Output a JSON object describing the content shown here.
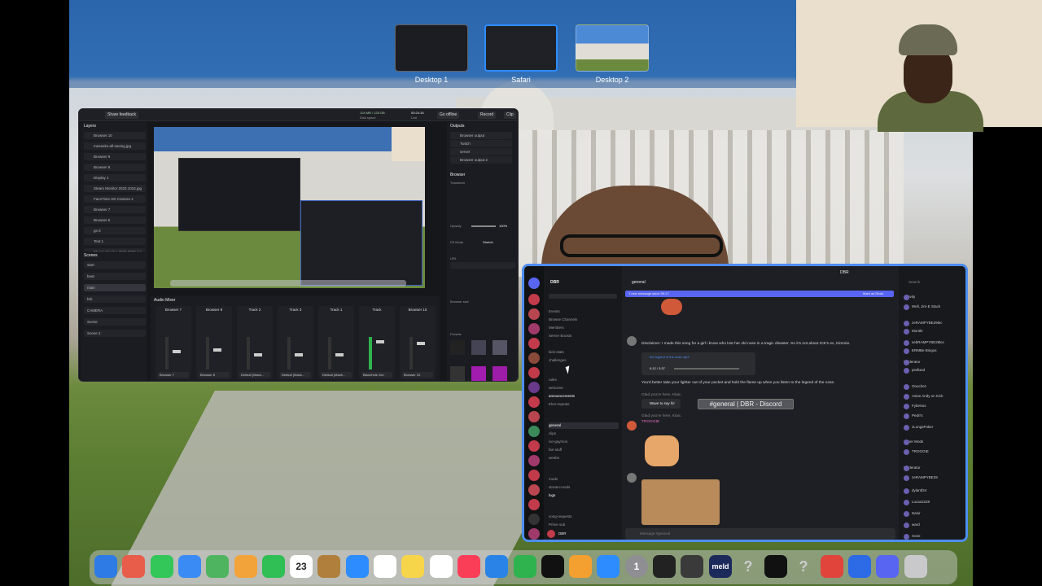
{
  "mission_control": {
    "spaces": [
      {
        "label": "Desktop 1",
        "selected": false
      },
      {
        "label": "Safari",
        "selected": true
      },
      {
        "label": "Desktop 2",
        "selected": false
      }
    ]
  },
  "obs": {
    "share_button": "Share feedback",
    "status_line1": "104 MB / 128 GB",
    "status_line2": "Disk space",
    "live_time": "00:24:16",
    "live_label": "Live",
    "go_offline": "Go offline",
    "record": "Record",
    "clip": "Clip",
    "sources_title": "Layers",
    "sources": [
      "Browser 10",
      "meseeks-all-seeing.jpg",
      "Browser 9",
      "Browser 8",
      "Display 1",
      "Steam Monitor 2023.1024.jpg",
      "FaceTime HD Camera 1",
      "Browser 7",
      "Browser 6",
      "gs-2",
      "Text 1",
      "Steam Monitor 2023.0720.jpg"
    ],
    "scenes_title": "Scenes",
    "scenes": [
      "start",
      "beat",
      "main",
      "brb",
      "CAMERA",
      "Scene",
      "Scene 2"
    ],
    "outputs_title": "Outputs",
    "outputs": [
      "Browser output",
      "Twitch",
      "server",
      "Browser output 2"
    ],
    "props_title": "Browser",
    "props_labels": [
      "Transform",
      "Opacity",
      "Fill Mode",
      "URL",
      "Browser size",
      "Presets"
    ],
    "opacity_value": "100%",
    "fill_mode": "Stretch",
    "mixer_title": "Audio Mixer",
    "channels": [
      {
        "name": "Browser 7",
        "select": "Browser 7"
      },
      {
        "name": "Browser 8",
        "select": "Browser 8"
      },
      {
        "name": "Track 2",
        "select": "Default (Macb..."
      },
      {
        "name": "Track 3",
        "select": "Default (Macb..."
      },
      {
        "name": "Track 1",
        "select": "Default (Macb..."
      },
      {
        "name": "Track",
        "select": "BlackHole 2ch"
      },
      {
        "name": "Browser 10",
        "select": "Browser 10"
      }
    ]
  },
  "discord": {
    "server_name": "DBR",
    "channel_title": "general",
    "window_title": "DBR",
    "new_messages_banner": "1 new message since 09:17",
    "mark_as_read": "Mark as Read",
    "search_placeholder": "Search",
    "channels": [
      {
        "name": "Events",
        "active": false
      },
      {
        "name": "Browse Channels",
        "active": false
      },
      {
        "name": "Members",
        "active": false
      },
      {
        "name": "Server Boosts",
        "active": false
      },
      {
        "name": "kick-stats",
        "active": false
      },
      {
        "name": "challenges",
        "active": false
      },
      {
        "name": "rules",
        "active": false
      },
      {
        "name": "welcome",
        "active": false
      },
      {
        "name": "announcements",
        "active": false
      },
      {
        "name": "Elon-repeats",
        "active": false
      },
      {
        "name": "general",
        "active": true
      },
      {
        "name": "clips",
        "active": false
      },
      {
        "name": "ice-gaymon",
        "active": false
      },
      {
        "name": "fan-stuff",
        "active": false
      },
      {
        "name": "weebs",
        "active": false
      },
      {
        "name": "mods",
        "active": false
      },
      {
        "name": "stream-mods",
        "active": false
      },
      {
        "name": "logs",
        "active": false
      },
      {
        "name": "song-requests",
        "active": false
      },
      {
        "name": "Prime sub",
        "active": false
      }
    ],
    "messages": [
      {
        "text": "Disclaimer: I made this song for a girl i know who lost her old nose in a tragic disaster. So it's not about ICE's ex, Kimmie."
      },
      {
        "text": "the legend of the nose.mp3"
      },
      {
        "text": "0:12 / 3:37"
      },
      {
        "text": "You'd better take your lighter out of your pocket and hold the flame up when you listen to the legend of the nose."
      },
      {
        "text": "Glad you're here, Klaic."
      },
      {
        "text": "Wave to say hi!"
      },
      {
        "text": "Glad you're here, Klaic."
      },
      {
        "text": "TROGGIE"
      }
    ],
    "tooltip": "#general | DBR - Discord",
    "message_placeholder": "Message #general",
    "user_name": "DBR",
    "members": [
      "Activity",
      "Well, Jim-E Stack",
      "zeRAMPYBE29lec",
      "Montle",
      "sebRAMPYBE29lec",
      "ERMBe Bingus",
      "Moderator",
      "pedlund",
      "Onuchez",
      "Asian Andy on Kick",
      "Fybertos",
      "Pedri's",
      "JLongsPoker",
      "Super Mods",
      "TROGGIE",
      "Moderator",
      "zeRAMPYBE29",
      "dylantf24",
      "Lucas2228",
      "Nasir",
      "ward",
      "Xone"
    ]
  },
  "dock": {
    "apps": [
      {
        "name": "finder-icon",
        "label": "",
        "color": "#2e7be6"
      },
      {
        "name": "launchpad-icon",
        "label": "",
        "color": "#e85c4a"
      },
      {
        "name": "messages-icon",
        "label": "",
        "color": "#33c759"
      },
      {
        "name": "mail-icon",
        "label": "",
        "color": "#3b8bf5"
      },
      {
        "name": "maps-icon",
        "label": "",
        "color": "#4fb45f"
      },
      {
        "name": "photos-icon",
        "label": "",
        "color": "#f2a33a"
      },
      {
        "name": "facetime-icon",
        "label": "",
        "color": "#2fbf54"
      },
      {
        "name": "calendar-icon",
        "label": "23",
        "color": "#ffffff"
      },
      {
        "name": "notes-folder-icon",
        "label": "",
        "color": "#b07f3c"
      },
      {
        "name": "safari-icon",
        "label": "",
        "color": "#2d8cff"
      },
      {
        "name": "reminders-icon",
        "label": "",
        "color": "#ffffff"
      },
      {
        "name": "notes-icon",
        "label": "",
        "color": "#f7d54a"
      },
      {
        "name": "freeform-icon",
        "label": "",
        "color": "#ffffff"
      },
      {
        "name": "music-icon",
        "label": "",
        "color": "#fa3e57"
      },
      {
        "name": "keynote-icon",
        "label": "",
        "color": "#2a84e8"
      },
      {
        "name": "numbers-icon",
        "label": "",
        "color": "#2fb34f"
      },
      {
        "name": "tv-icon",
        "label": "",
        "color": "#111111"
      },
      {
        "name": "pages-icon",
        "label": "",
        "color": "#f4a031"
      },
      {
        "name": "app-store-icon",
        "label": "",
        "color": "#2d8cff"
      },
      {
        "name": "settings-icon",
        "label": "1",
        "color": "#8e8e93"
      },
      {
        "name": "obs-icon",
        "label": "",
        "color": "#222222"
      },
      {
        "name": "davinci-icon",
        "label": "",
        "color": "#3a3a3a"
      },
      {
        "name": "meld-icon",
        "label": "meld",
        "color": "#1b2a5a"
      },
      {
        "name": "help-icon",
        "label": "?",
        "color": "#9aa0a8"
      },
      {
        "name": "capcut-icon",
        "label": "",
        "color": "#111111"
      },
      {
        "name": "help-icon-2",
        "label": "?",
        "color": "#9aa0a8"
      },
      {
        "name": "chrome-icon",
        "label": "",
        "color": "#e0443a"
      },
      {
        "name": "brave-icon",
        "label": "",
        "color": "#2d6ae6"
      },
      {
        "name": "discord-icon",
        "label": "",
        "color": "#5865f2"
      },
      {
        "name": "trash-icon",
        "label": "",
        "color": "#c9c9cc"
      }
    ]
  }
}
